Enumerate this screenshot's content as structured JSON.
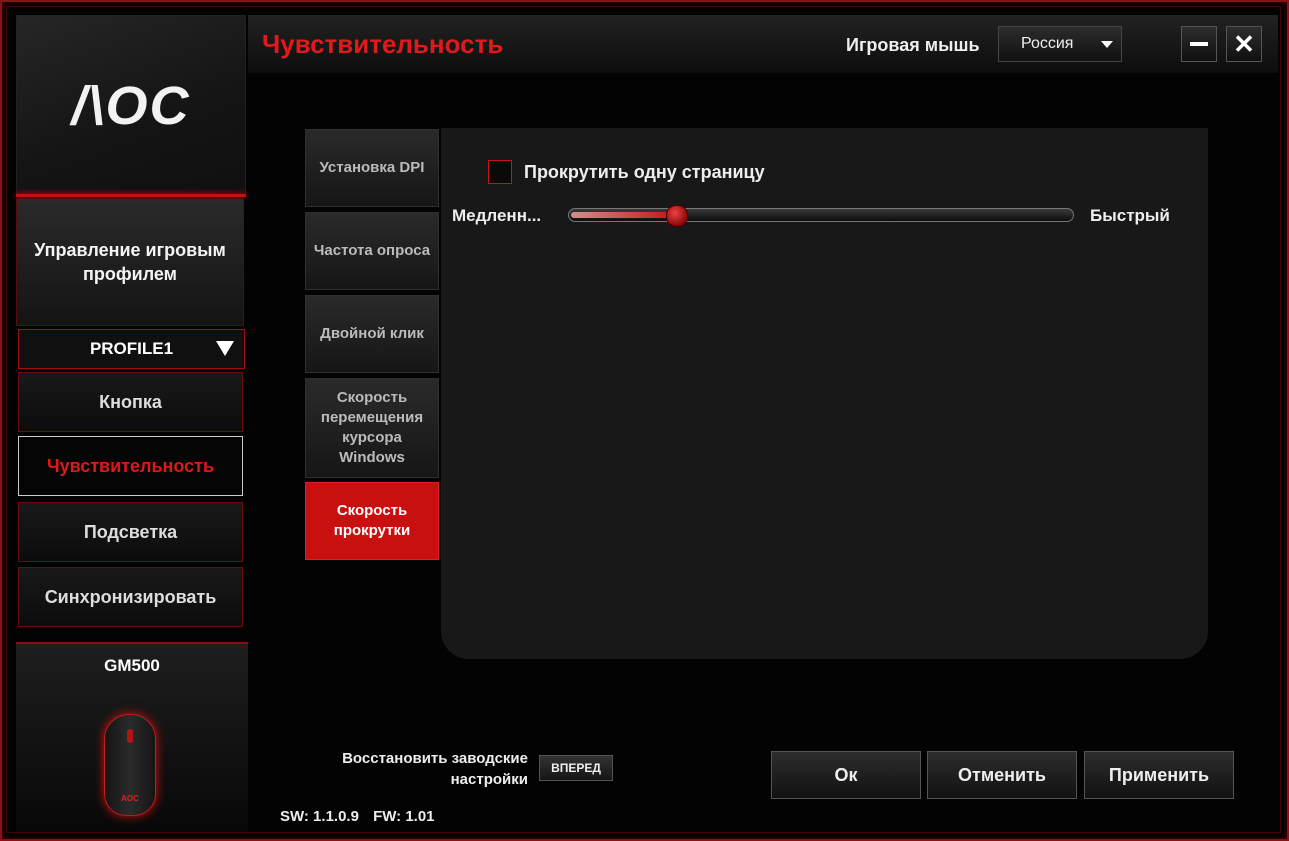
{
  "logo": {
    "text": "/\\OC"
  },
  "sidebar": {
    "profile_management": "Управление игровым профилем",
    "profile_select": "PROFILE1",
    "items": [
      {
        "label": "Кнопка"
      },
      {
        "label": "Чувствительность"
      },
      {
        "label": "Подсветка"
      },
      {
        "label": "Синхронизировать"
      }
    ],
    "device_name": "GM500",
    "device_logo": "AOC"
  },
  "header": {
    "title": "Чувствительность",
    "device_type_label": "Игровая мышь",
    "region_select": "Россия"
  },
  "sub_tabs": [
    {
      "label": "Установка DPI"
    },
    {
      "label": "Частота опроса"
    },
    {
      "label": "Двойной клик"
    },
    {
      "label": "Скорость перемещения курсора Windows"
    },
    {
      "label": "Скорость прокрутки"
    }
  ],
  "content": {
    "checkbox_label": "Прокрутить одну страницу",
    "checkbox_checked": false,
    "slider_min_label": "Медленн...",
    "slider_max_label": "Быстрый",
    "slider_value_fraction": 0.21
  },
  "footer": {
    "restore_label": "Восстановить заводские настройки",
    "restore_button": "ВПЕРЕД",
    "sw_version": "SW: 1.1.0.9",
    "fw_version": "FW: 1.01",
    "ok_button": "Ок",
    "cancel_button": "Отменить",
    "apply_button": "Применить"
  },
  "colors": {
    "accent": "#e01a1a",
    "background": "#030303",
    "panel": "#181818"
  }
}
